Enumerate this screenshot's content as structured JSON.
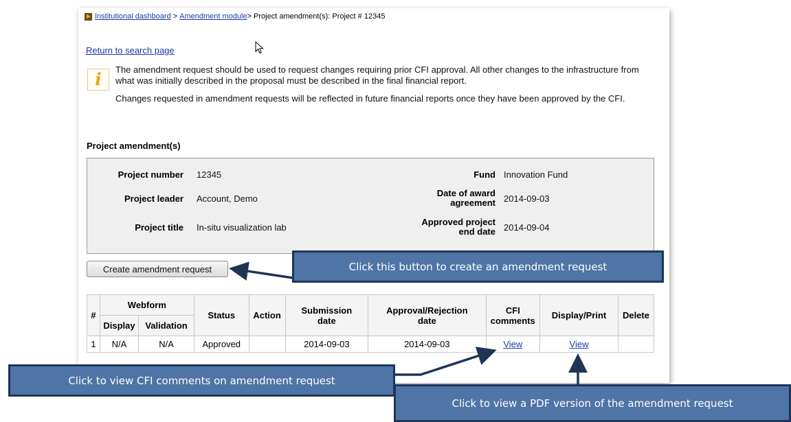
{
  "breadcrumb": {
    "item1": "Institutional dashboard",
    "sep1": ">",
    "item2": "Amendment module",
    "current": "> Project amendment(s): Project # 12345"
  },
  "return_link": "Return to search page",
  "info": {
    "paragraph1": "The amendment request should be used to request changes requiring prior CFI approval. All other changes to the infrastructure from what was initially described in the proposal must be described in the final financial report.",
    "paragraph2": "Changes requested in amendment requests will be reflected in future financial reports once they have been approved by the CFI."
  },
  "section_title": "Project amendment(s)",
  "project": {
    "number_label": "Project number",
    "number": "12345",
    "leader_label": "Project leader",
    "leader": "Account, Demo",
    "title_label": "Project title",
    "title": "In-situ visualization lab",
    "fund_label": "Fund",
    "fund": "Innovation Fund",
    "award_label_1": "Date of award",
    "award_label_2": "agreement",
    "award_date": "2014-09-03",
    "end_label_1": "Approved project",
    "end_label_2": "end date",
    "end_date": "2014-09-04"
  },
  "create_button": "Create amendment request",
  "table": {
    "headers": {
      "num": "#",
      "webform": "Webform",
      "display": "Display",
      "validation": "Validation",
      "status": "Status",
      "action": "Action",
      "submission_1": "Submission",
      "submission_2": "date",
      "approval_1": "Approval/Rejection",
      "approval_2": "date",
      "cfi_1": "CFI",
      "cfi_2": "comments",
      "display_print": "Display/Print",
      "delete": "Delete"
    },
    "rows": [
      {
        "num": "1",
        "display": "N/A",
        "validation": "N/A",
        "status": "Approved",
        "action": "",
        "submission": "2014-09-03",
        "approval": "2014-09-03",
        "cfi": "View",
        "print": "View",
        "delete": ""
      }
    ]
  },
  "callouts": {
    "create": "Click this button to create an amendment request",
    "cfi": "Click to view CFI comments on amendment request",
    "pdf": "Click to view a PDF version of the amendment request"
  },
  "colors": {
    "callout_fill": "#4f74a6",
    "callout_border": "#1f3556",
    "link": "#1a3aa6",
    "crumb_icon": "#f2b21a"
  }
}
